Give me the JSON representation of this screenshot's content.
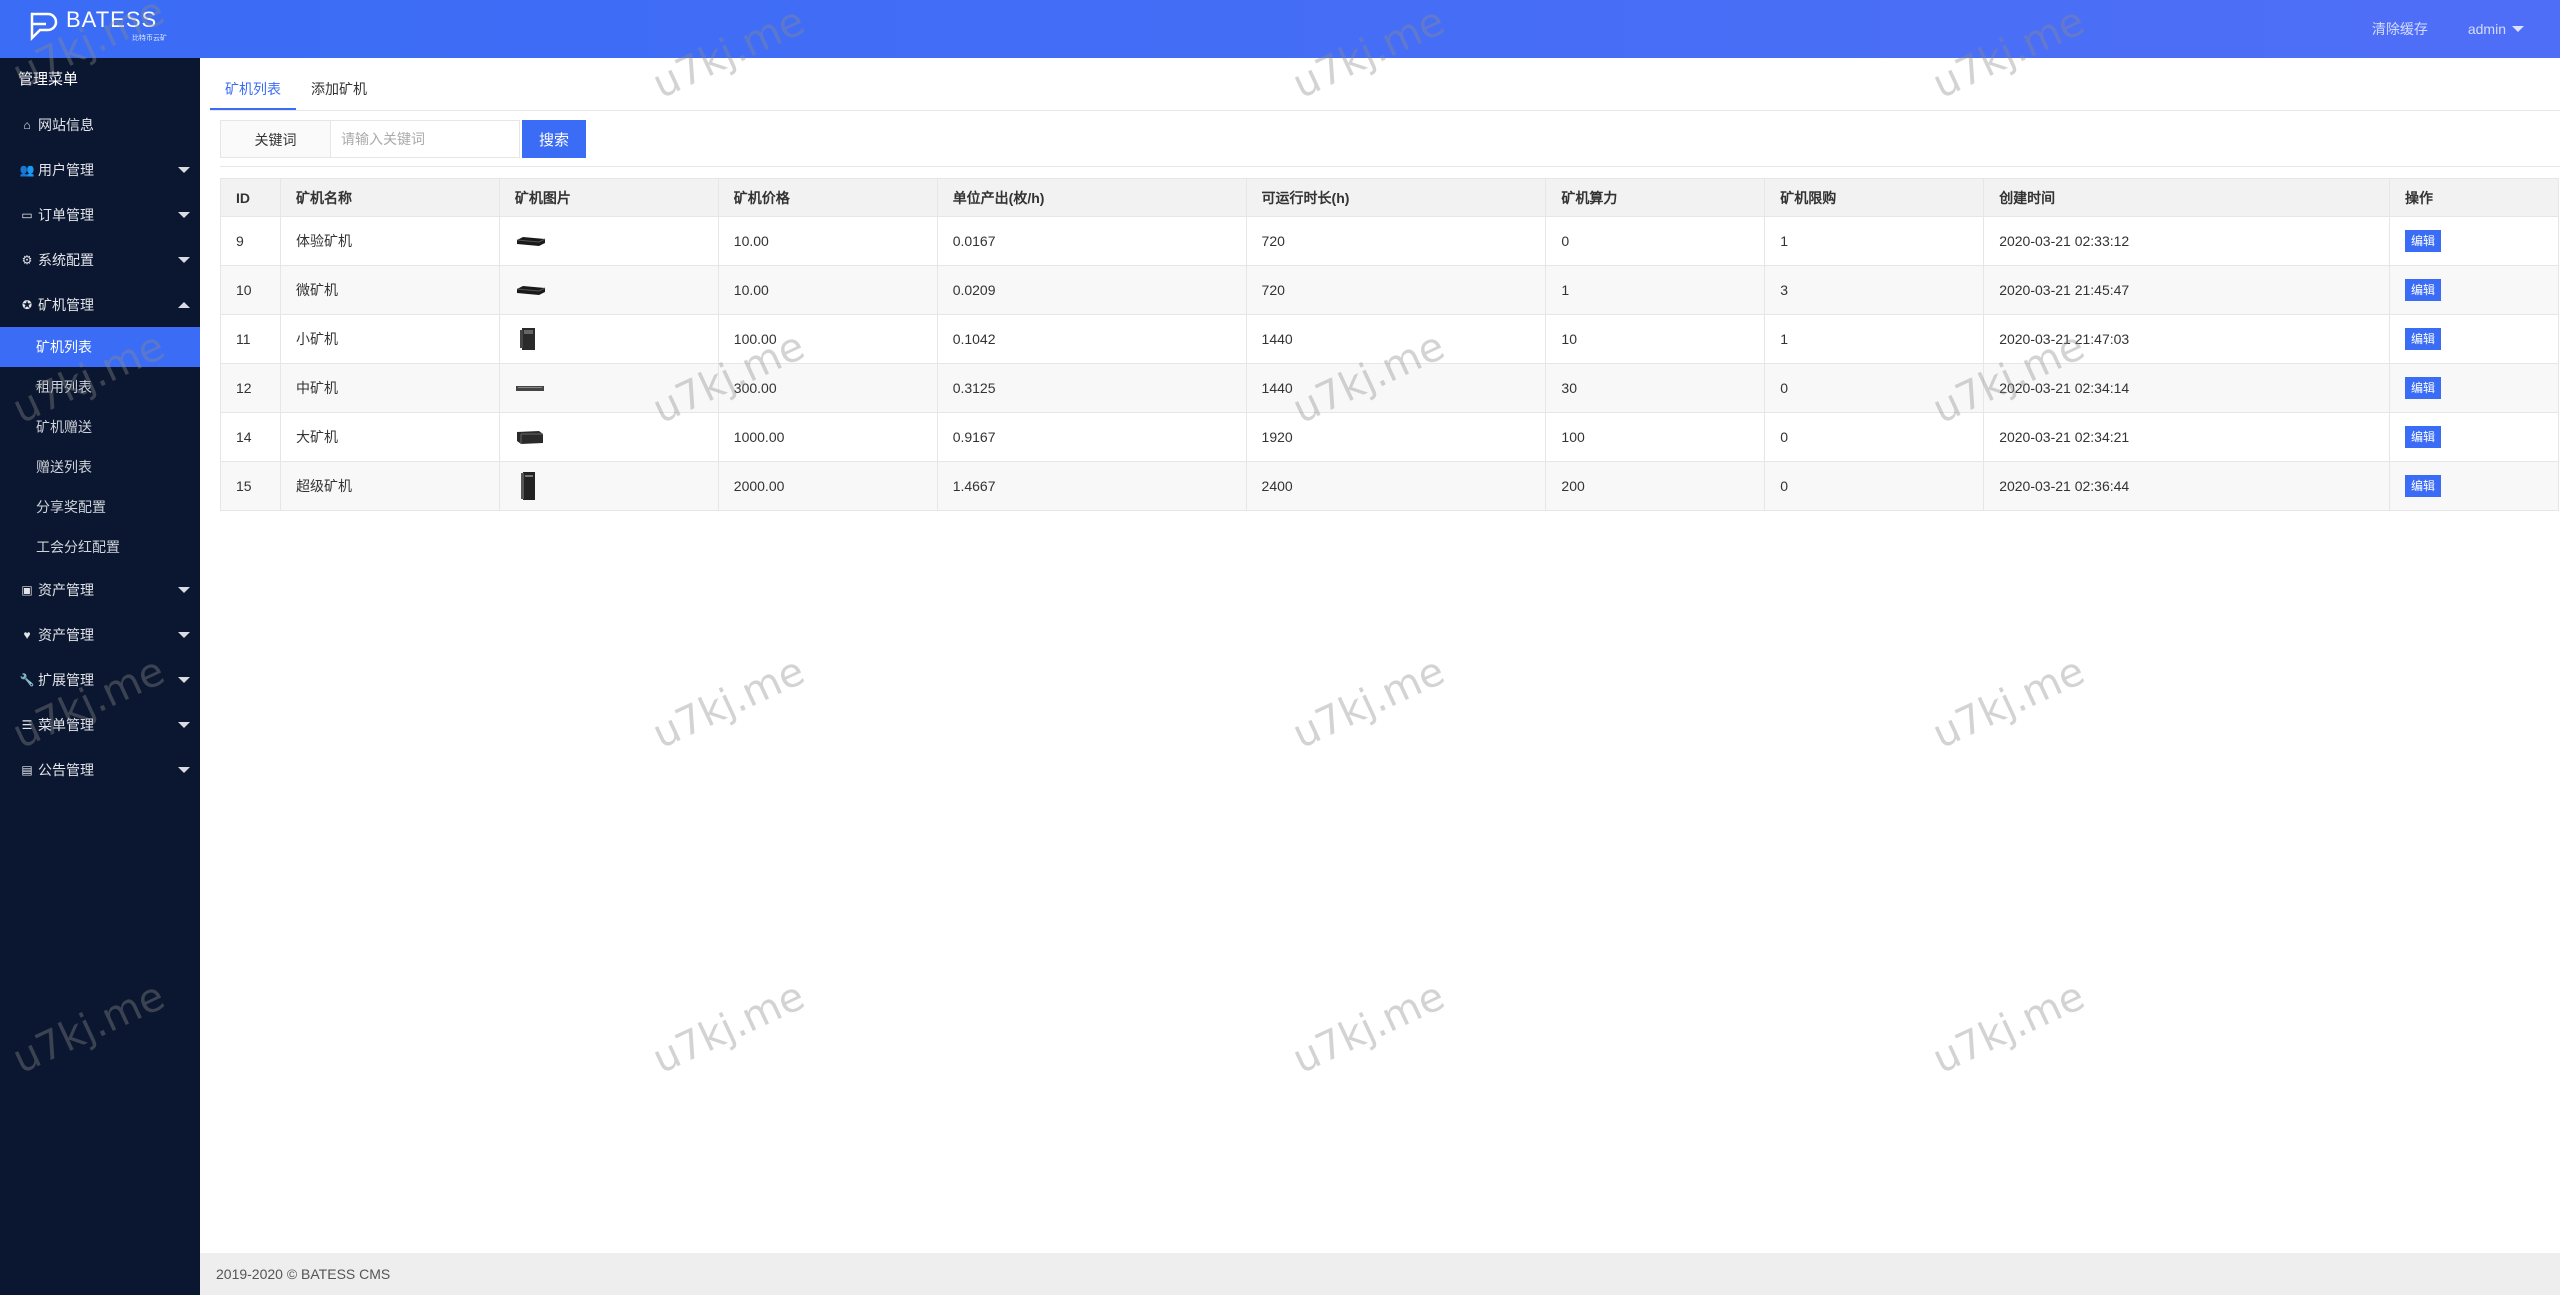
{
  "header": {
    "logo_name": "BATESS",
    "logo_sub": "比特币云矿",
    "clear_cache": "清除缓存",
    "user": "admin"
  },
  "sidebar": {
    "title": "管理菜单",
    "items": [
      {
        "label": "网站信息",
        "icon": "home-icon"
      },
      {
        "label": "用户管理",
        "icon": "users-icon"
      },
      {
        "label": "订单管理",
        "icon": "credit-card-icon"
      },
      {
        "label": "系统配置",
        "icon": "cogs-icon"
      },
      {
        "label": "矿机管理",
        "icon": "rebel-icon"
      },
      {
        "label": "资产管理",
        "icon": "money-icon"
      },
      {
        "label": "资产管理",
        "icon": "heartbeat-icon"
      },
      {
        "label": "扩展管理",
        "icon": "wrench-icon"
      },
      {
        "label": "菜单管理",
        "icon": "list-icon"
      },
      {
        "label": "公告管理",
        "icon": "file-icon"
      }
    ],
    "sub_items": [
      "矿机列表",
      "租用列表",
      "矿机赠送",
      "赠送列表",
      "分享奖配置",
      "工会分红配置"
    ]
  },
  "tabs": [
    "矿机列表",
    "添加矿机"
  ],
  "search": {
    "label": "关键词",
    "placeholder": "请输入关键词",
    "button": "搜索"
  },
  "table": {
    "headers": [
      "ID",
      "矿机名称",
      "矿机图片",
      "矿机价格",
      "单位产出(枚/h)",
      "可运行时长(h)",
      "矿机算力",
      "矿机限购",
      "创建时间",
      "操作"
    ],
    "rows": [
      {
        "id": "9",
        "name": "体验矿机",
        "image": "flat-unit",
        "price": "10.00",
        "output": "0.0167",
        "hours": "720",
        "power": "0",
        "limit": "1",
        "created": "2020-03-21 02:33:12"
      },
      {
        "id": "10",
        "name": "微矿机",
        "image": "flat-unit",
        "price": "10.00",
        "output": "0.0209",
        "hours": "720",
        "power": "1",
        "limit": "3",
        "created": "2020-03-21 21:45:47"
      },
      {
        "id": "11",
        "name": "小矿机",
        "image": "tower-small",
        "price": "100.00",
        "output": "0.1042",
        "hours": "1440",
        "power": "10",
        "limit": "1",
        "created": "2020-03-21 21:47:03"
      },
      {
        "id": "12",
        "name": "中矿机",
        "image": "rack-thin",
        "price": "300.00",
        "output": "0.3125",
        "hours": "1440",
        "power": "30",
        "limit": "0",
        "created": "2020-03-21 02:34:14"
      },
      {
        "id": "14",
        "name": "大矿机",
        "image": "box-unit",
        "price": "1000.00",
        "output": "0.9167",
        "hours": "1920",
        "power": "100",
        "limit": "0",
        "created": "2020-03-21 02:34:21"
      },
      {
        "id": "15",
        "name": "超级矿机",
        "image": "tower-tall",
        "price": "2000.00",
        "output": "1.4667",
        "hours": "2400",
        "power": "200",
        "limit": "0",
        "created": "2020-03-21 02:36:44"
      }
    ],
    "edit_label": "编辑"
  },
  "footer": "2019-2020 © BATESS CMS",
  "watermark": "u7kj.me",
  "colors": {
    "primary": "#3b6cf5",
    "sidebar": "#0b1730"
  }
}
